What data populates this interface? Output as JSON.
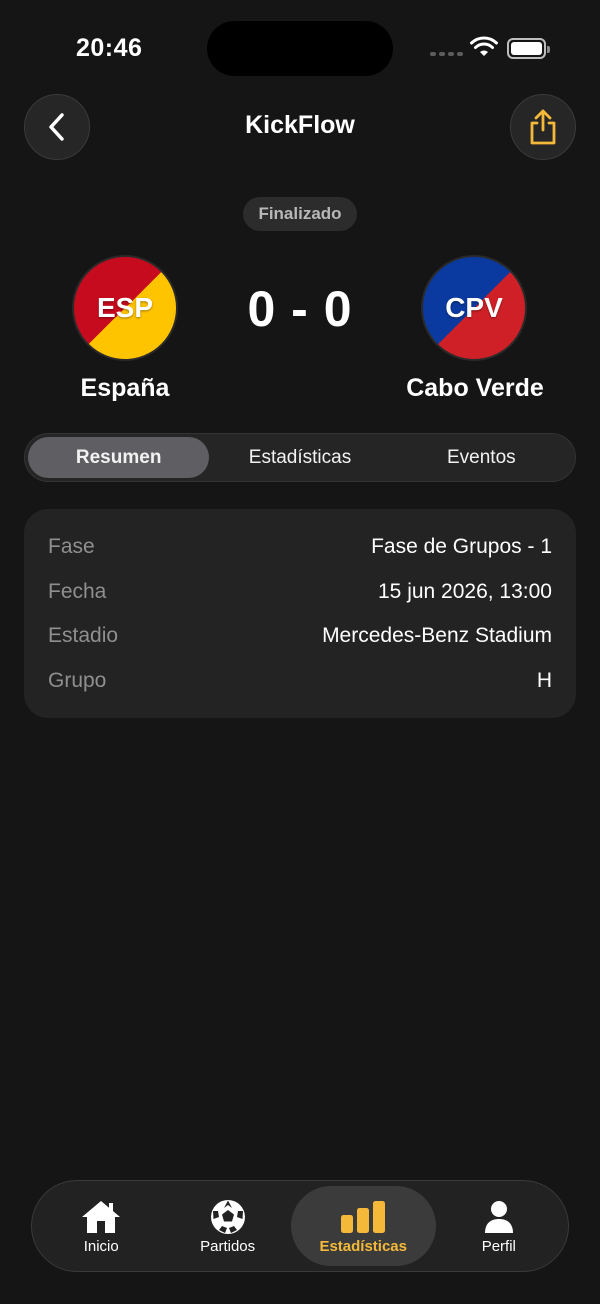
{
  "status_bar": {
    "time": "20:46"
  },
  "header": {
    "title": "KickFlow"
  },
  "match": {
    "status": "Finalizado",
    "home": {
      "code": "ESP",
      "name": "España"
    },
    "away": {
      "code": "CPV",
      "name": "Cabo Verde"
    },
    "score": "0 - 0"
  },
  "tabs": [
    {
      "label": "Resumen",
      "active": true
    },
    {
      "label": "Estadísticas",
      "active": false
    },
    {
      "label": "Eventos",
      "active": false
    }
  ],
  "info": [
    {
      "label": "Fase",
      "value": "Fase de Grupos - 1"
    },
    {
      "label": "Fecha",
      "value": "15 jun 2026, 13:00"
    },
    {
      "label": "Estadio",
      "value": "Mercedes-Benz Stadium"
    },
    {
      "label": "Grupo",
      "value": "H"
    }
  ],
  "nav": [
    {
      "label": "Inicio",
      "icon": "home-icon"
    },
    {
      "label": "Partidos",
      "icon": "soccer-ball-icon"
    },
    {
      "label": "Estadísticas",
      "icon": "bar-chart-icon",
      "active": true
    },
    {
      "label": "Perfil",
      "icon": "person-icon"
    }
  ],
  "colors": {
    "background": "#151515",
    "accent": "#f5b93a",
    "card": "#232323",
    "spain_red": "#c60b1e",
    "spain_yellow": "#ffc400",
    "cpv_blue": "#0a3aa0",
    "cpv_red": "#cf2027"
  }
}
